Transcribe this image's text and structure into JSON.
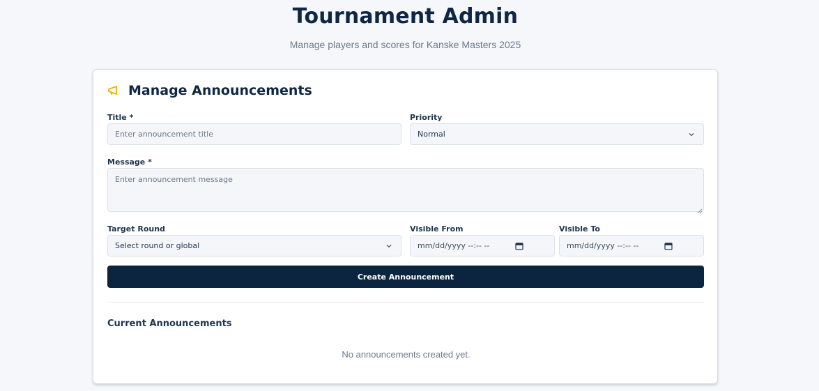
{
  "header": {
    "title": "Tournament Admin",
    "subtitle": "Manage players and scores for Kanske Masters 2025"
  },
  "announcements": {
    "heading": "Manage Announcements",
    "icon": "megaphone-icon",
    "accent_color": "#f0b100",
    "form": {
      "title_label": "Title *",
      "title_placeholder": "Enter announcement title",
      "priority_label": "Priority",
      "priority_value": "Normal",
      "message_label": "Message *",
      "message_placeholder": "Enter announcement message",
      "target_round_label": "Target Round",
      "target_round_value": "Select round or global",
      "visible_from_label": "Visible From",
      "visible_from_value": "mm/dd/yyyy --:-- --",
      "visible_to_label": "Visible To",
      "visible_to_value": "mm/dd/yyyy --:-- --",
      "submit_label": "Create Announcement",
      "submit_color": "#0b2440"
    },
    "current": {
      "title": "Current Announcements",
      "empty_text": "No announcements created yet."
    }
  }
}
